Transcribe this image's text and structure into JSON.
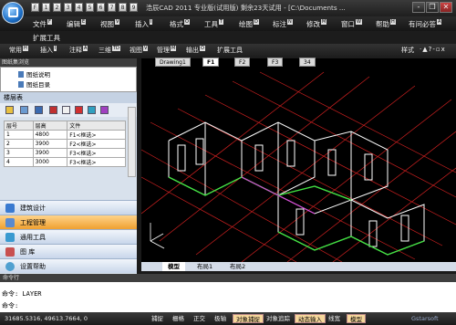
{
  "title_bar": {
    "title": "浩辰CAD 2011 专业版(试用版) 剩余23天试用 - [C:\\Documents ...",
    "window_controls": [
      "-",
      "❐",
      "✕"
    ],
    "quick_access_keys": [
      "F",
      "1",
      "2",
      "3",
      "4",
      "5",
      "6",
      "7",
      "8",
      "9"
    ]
  },
  "menu_bar": {
    "items": [
      {
        "label": "文件",
        "key": "F"
      },
      {
        "label": "编辑",
        "key": "E"
      },
      {
        "label": "视图",
        "key": "V"
      },
      {
        "label": "插入",
        "key": "I"
      },
      {
        "label": "格式",
        "key": "O"
      },
      {
        "label": "工具",
        "key": "T"
      },
      {
        "label": "绘图",
        "key": "D"
      },
      {
        "label": "标注",
        "key": "N"
      },
      {
        "label": "修改",
        "key": "M"
      },
      {
        "label": "窗口",
        "key": "W"
      },
      {
        "label": "帮助",
        "key": "H"
      },
      {
        "label": "有问必答",
        "key": "A"
      }
    ],
    "extra_tools": "扩展工具"
  },
  "ribbon": {
    "tabs": [
      {
        "label": "常用",
        "key": "H"
      },
      {
        "label": "插入",
        "key": "I"
      },
      {
        "label": "注释",
        "key": "A"
      },
      {
        "label": "三维",
        "key": "TD"
      },
      {
        "label": "视图",
        "key": "V"
      },
      {
        "label": "管理",
        "key": "M"
      },
      {
        "label": "输出",
        "key": "O"
      },
      {
        "label": "扩展工具",
        "key": ""
      }
    ],
    "style_label": "样式",
    "style_controls": [
      "·",
      "▲",
      "?",
      "-",
      "▫",
      "x"
    ]
  },
  "left_panel": {
    "title": "图纸集浏览",
    "tree_items": [
      "图纸说明",
      "图纸目录"
    ],
    "layer_table": {
      "heading": "楼层表",
      "columns": [
        "层号",
        "层高",
        "文件"
      ],
      "rows": [
        [
          "1",
          "4800",
          "F1<框选>"
        ],
        [
          "2",
          "3900",
          "F2<框选>"
        ],
        [
          "3",
          "3900",
          "F3<框选>"
        ],
        [
          "4",
          "3000",
          "F3<框选>"
        ]
      ]
    },
    "nav_buttons": [
      {
        "label": "建筑设计",
        "icon": "building-icon",
        "active": false
      },
      {
        "label": "工程管理",
        "icon": "project-icon",
        "active": true
      },
      {
        "label": "通用工具",
        "icon": "tools-icon",
        "active": false
      },
      {
        "label": "图    库",
        "icon": "library-icon",
        "active": false
      },
      {
        "label": "设置帮助",
        "icon": "help-icon",
        "active": false
      }
    ]
  },
  "drawing_tabs": [
    "Drawing1",
    "F1",
    "F2",
    "F3",
    "34"
  ],
  "layout_tabs": [
    "模型",
    "布局1",
    "布局2"
  ],
  "command": {
    "title": "命令行",
    "lines": [
      "命令: LAYER",
      "命令:"
    ]
  },
  "status_bar": {
    "coordinates": "31685.5316, 49613.7664, 0",
    "toggles": [
      {
        "label": "捕捉",
        "on": false
      },
      {
        "label": "栅格",
        "on": false
      },
      {
        "label": "正交",
        "on": false
      },
      {
        "label": "极轴",
        "on": false
      },
      {
        "label": "对象捕捉",
        "on": true
      },
      {
        "label": "对象追踪",
        "on": false
      },
      {
        "label": "动态输入",
        "on": true
      },
      {
        "label": "线宽",
        "on": false
      },
      {
        "label": "模型",
        "on": true
      }
    ],
    "brand": "Gstarsoft"
  },
  "colors": {
    "accent": "#f0a030",
    "wall": "#ffffff",
    "axis_lines": "#cc2020",
    "slab_edge": "#40e040",
    "highlight": "#d040d0"
  }
}
